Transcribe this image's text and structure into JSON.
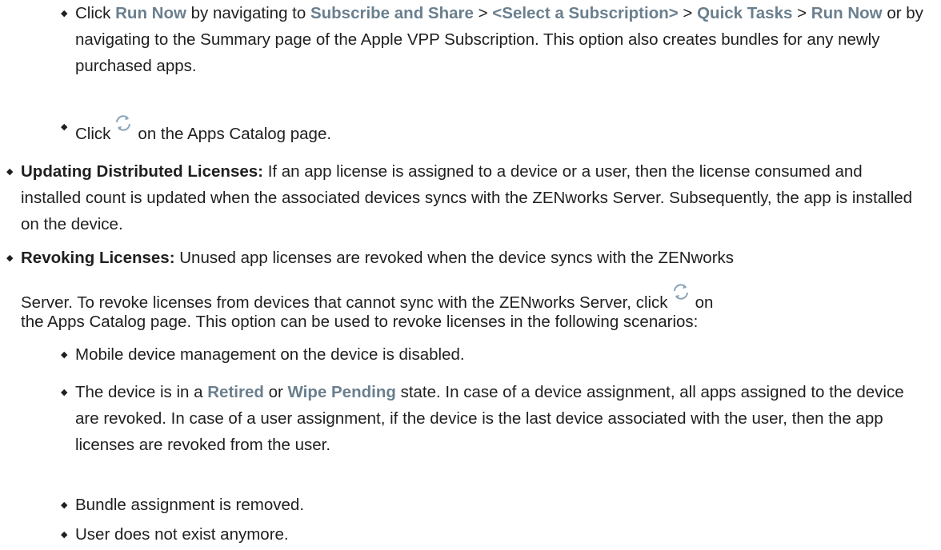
{
  "items": {
    "run_now": {
      "click": "Click",
      "run_now_label": "Run Now",
      "by_navigating": "by navigating to",
      "subscribe_share": "Subscribe and Share",
      "sep1": ">",
      "select_subscription": "<Select a Subscription>",
      "sep2": ">",
      "quick_tasks": "Quick Tasks",
      "sep3": ">",
      "run_now_label2": "Run Now",
      "rest": "or by navigating to the Summary page of the Apple VPP Subscription. This option also creates bundles for any newly purchased apps."
    },
    "click_icon": {
      "click": "Click",
      "rest": "on the Apps Catalog page."
    },
    "updating": {
      "term": "Updating Distributed Licenses:",
      "text": "If an app license is assigned to a device or a user, then the license consumed and installed count is updated when the associated devices syncs with the ZENworks Server. Subsequently, the app is installed on the device."
    },
    "revoking": {
      "term": "Revoking Licenses:",
      "text1": "Unused app licenses are revoked when the device syncs with the ZENworks",
      "text2": "Server. To revoke licenses from devices that cannot sync with the ZENworks Server, click",
      "text3": "on",
      "text4": "the Apps Catalog page. This option can be used to revoke licenses in the following scenarios:"
    },
    "scenarios": {
      "mdm": "Mobile device management on the device is disabled.",
      "state_pre": "The device is in a",
      "retired": "Retired",
      "or": "or",
      "wipe_pending": "Wipe Pending",
      "state_rest": "state. In case of a device assignment, all apps assigned to the device are revoked. In case of a user assignment, if the device is the last device associated with the user, then the app licenses are revoked from the user.",
      "bundle": "Bundle assignment is removed.",
      "user": "User does not exist anymore."
    }
  },
  "icons": {
    "bullet": "diamond-bullet",
    "refresh": "refresh-icon"
  },
  "colors": {
    "ui_text": "#6a7f8e",
    "body_text": "#1f1f1f"
  }
}
